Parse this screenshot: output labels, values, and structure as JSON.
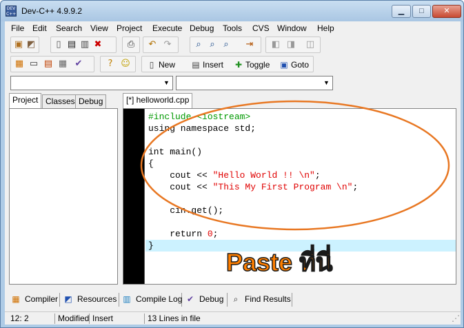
{
  "window": {
    "title": "Dev-C++ 4.9.9.2",
    "app_icon_text": "DEV C++"
  },
  "menu": [
    "File",
    "Edit",
    "Search",
    "View",
    "Project",
    "Execute",
    "Debug",
    "Tools",
    "CVS",
    "Window",
    "Help"
  ],
  "toolbar": {
    "new_label": "New",
    "insert_label": "Insert",
    "toggle_label": "Toggle",
    "goto_label": "Goto"
  },
  "left_tabs": [
    "Project",
    "Classes",
    "Debug"
  ],
  "editor": {
    "tab_label": "[*] helloworld.cpp",
    "lines": [
      "#include <iostream>",
      "using namespace std;",
      "",
      "int main()",
      "{",
      "    cout << \"Hello World !! \\n\";",
      "    cout << \"This My First Program \\n\";",
      "",
      "    cin.get();",
      "",
      "    return 0;",
      "}"
    ]
  },
  "annotation": {
    "text": "Paste ที่นี่",
    "color": "#ff7f00"
  },
  "bottom_tabs": [
    "Compiler",
    "Resources",
    "Compile Log",
    "Debug",
    "Find Results"
  ],
  "status": {
    "position": "12: 2",
    "modified": "Modified",
    "mode": "Insert",
    "line_count": "13 Lines in file"
  }
}
